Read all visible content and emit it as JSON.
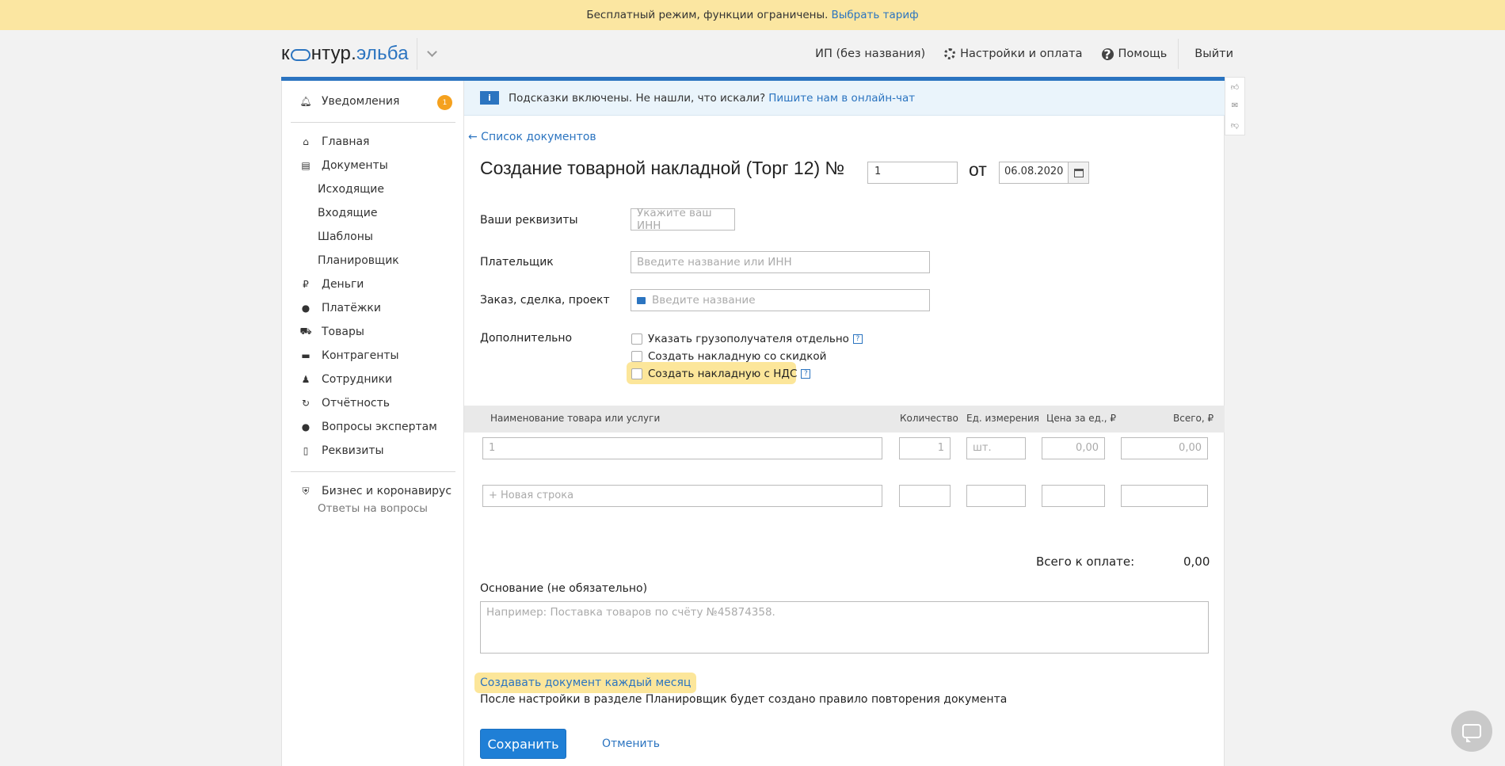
{
  "banner": {
    "text": "Бесплатный режим, функции ограничены.",
    "link": "Выбрать тариф"
  },
  "header": {
    "logo_a": "к",
    "logo_b": "нтур",
    "logo_sep": ".",
    "logo_c": "эльба",
    "company": "ИП (без названия)",
    "settings": "Настройки и оплата",
    "help": "Помощь",
    "exit": "Выйти"
  },
  "sidebar": {
    "notifications": {
      "label": "Уведомления",
      "count": "1"
    },
    "items": [
      {
        "label": "Главная",
        "icon": "home-icon"
      },
      {
        "label": "Документы",
        "icon": "documents-icon"
      },
      {
        "label": "Исходящие"
      },
      {
        "label": "Входящие"
      },
      {
        "label": "Шаблоны"
      },
      {
        "label": "Планировщик"
      },
      {
        "label": "Деньги",
        "icon": "money-icon"
      },
      {
        "label": "Платёжки",
        "icon": "payments-icon"
      },
      {
        "label": "Товары",
        "icon": "cart-icon"
      },
      {
        "label": "Контрагенты",
        "icon": "briefcase-icon"
      },
      {
        "label": "Сотрудники",
        "icon": "person-icon"
      },
      {
        "label": "Отчётность",
        "icon": "report-icon"
      },
      {
        "label": "Вопросы экспертам",
        "icon": "question-icon"
      },
      {
        "label": "Реквизиты",
        "icon": "book-icon"
      }
    ],
    "corona": {
      "label": "Бизнес и коронавирус",
      "note": "Ответы на вопросы"
    }
  },
  "hint": {
    "text": "Подсказки включены. Не нашли, что искали?",
    "link": "Пишите нам в онлайн-чат",
    "badge": "i"
  },
  "form": {
    "back": "← Список документов",
    "title": "Создание товарной накладной (Торг 12) №",
    "number": "1",
    "ot": "от",
    "date": "06.08.2020",
    "requisites_label": "Ваши реквизиты",
    "requisites_placeholder": "Укажите ваш ИНН",
    "payer_label": "Плательщик",
    "payer_placeholder": "Введите название или ИНН",
    "order_label": "Заказ, сделка, проект",
    "order_placeholder": "Введите название",
    "extra_label": "Дополнительно",
    "cb1": "Указать грузополучателя отдельно",
    "cb2": "Создать накладную со скидкой",
    "cb3": "Создать накладную с НДС",
    "qmark": "?"
  },
  "table": {
    "headers": {
      "name": "Наименование товара или услуги",
      "qty": "Количество",
      "unit": "Ед. измерения",
      "price": "Цена за ед., ₽",
      "total": "Всего, ₽"
    },
    "row": {
      "name": "1",
      "qty": "1",
      "unit": "шт.",
      "price": "0,00",
      "total": "0,00"
    },
    "new_row": "+ Новая строка"
  },
  "totals": {
    "label": "Всего к оплате:",
    "value": "0,00"
  },
  "basis": {
    "label": "Основание (не обязательно)",
    "placeholder": "Например: Поставка товаров по счёту №45874358."
  },
  "monthly": {
    "link": "Создавать документ каждый месяц",
    "note": "После настройки в разделе Планировщик будет создано правило повторения документа"
  },
  "actions": {
    "save": "Сохранить",
    "cancel": "Отменить"
  }
}
